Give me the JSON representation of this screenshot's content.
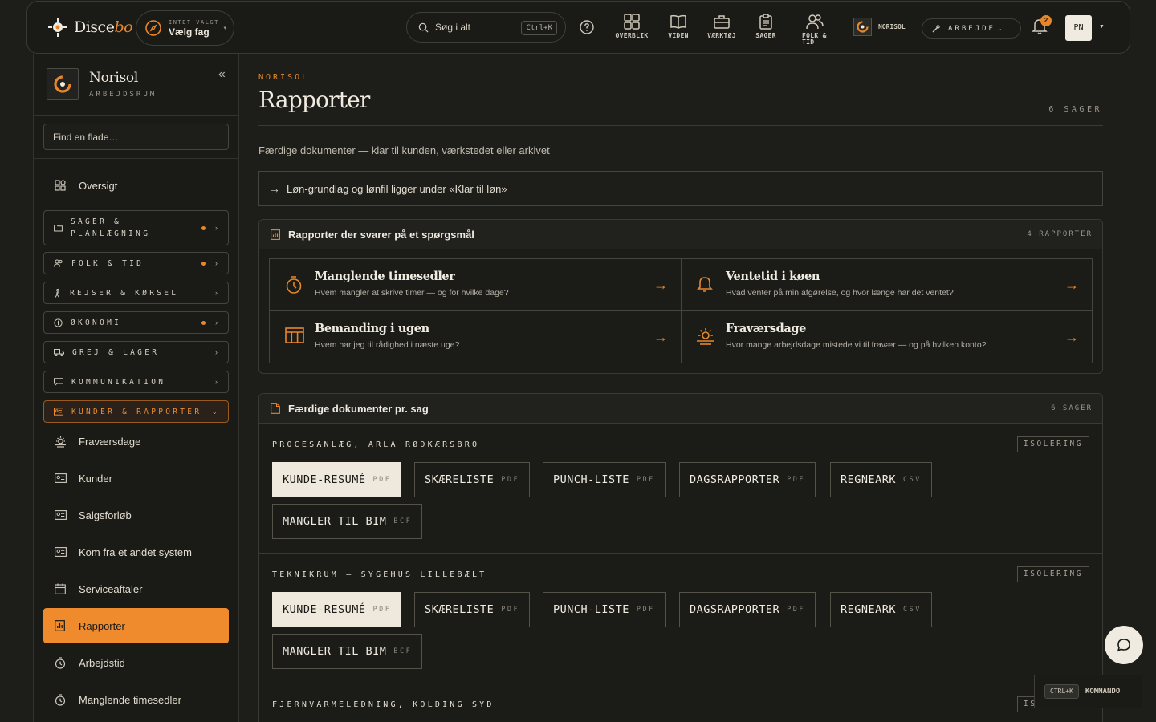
{
  "brand": {
    "name_a": "Disce",
    "name_b": "bo",
    "accent": "#e8872a"
  },
  "topbar": {
    "trade_small": "INTET VALGT",
    "trade_label": "Vælg fag",
    "search_label": "Søg i alt",
    "search_kbd": "Ctrl+K",
    "nav": [
      {
        "label": "OVERBLIK",
        "icon": "grid-icon"
      },
      {
        "label": "VIDEN",
        "icon": "book-icon"
      },
      {
        "label": "VÆRKTØJ",
        "icon": "toolbox-icon"
      },
      {
        "label": "SAGER",
        "icon": "clipboard-icon"
      },
      {
        "label_1": "FOLK &",
        "label_2": "TID",
        "icon": "people-icon"
      }
    ],
    "workspace_chip": "NORISOL",
    "mode_label": "ARBEJDE",
    "notification_count": "2",
    "avatar_initials": "PN"
  },
  "sidebar": {
    "workspace_name": "Norisol",
    "workspace_sub": "ARBEJDSRUM",
    "find_placeholder": "Find en flade…",
    "overview": "Oversigt",
    "groups": [
      {
        "label_1": "SAGER &",
        "label_2": "PLANLÆGNING",
        "dot": true
      },
      {
        "label": "FOLK & TID",
        "dot": true
      },
      {
        "label": "REJSER & KØRSEL",
        "dot": false
      },
      {
        "label": "ØKONOMI",
        "dot": true
      },
      {
        "label": "GREJ & LAGER",
        "dot": false
      },
      {
        "label": "KOMMUNIKATION",
        "dot": false
      },
      {
        "label": "KUNDER & RAPPORTER",
        "dot": false,
        "open": true
      }
    ],
    "items": [
      {
        "label": "Fraværsdage",
        "icon": "sun-horizon-icon"
      },
      {
        "label": "Kunder",
        "icon": "id-card-icon"
      },
      {
        "label": "Salgsforløb",
        "icon": "id-card-icon"
      },
      {
        "label": "Kom fra et andet system",
        "icon": "id-card-icon"
      },
      {
        "label": "Serviceaftaler",
        "icon": "calendar-icon"
      },
      {
        "label": "Rapporter",
        "icon": "report-icon",
        "active": true
      },
      {
        "label": "Arbejdstid",
        "icon": "stopwatch-icon"
      },
      {
        "label": "Manglende timesedler",
        "icon": "stopwatch-icon"
      }
    ]
  },
  "main": {
    "eyebrow": "NORISOL",
    "title": "Rapporter",
    "count": "6 SAGER",
    "subtitle": "Færdige dokumenter — klar til kunden, værkstedet eller arkivet",
    "notice": "Løn-grundlag og lønfil ligger under «Klar til løn»",
    "questions_panel": {
      "title": "Rapporter der svarer på et spørgsmål",
      "count": "4 RAPPORTER",
      "items": [
        {
          "title": "Manglende timesedler",
          "desc": "Hvem mangler at skrive timer — og for hvilke dage?",
          "icon": "stopwatch-icon"
        },
        {
          "title": "Ventetid i køen",
          "desc": "Hvad venter på min afgørelse, og hvor længe har det ventet?",
          "icon": "bell-icon"
        },
        {
          "title": "Bemanding i ugen",
          "desc": "Hvem har jeg til rådighed i næste uge?",
          "icon": "calendar-week-icon"
        },
        {
          "title": "Fraværsdage",
          "desc": "Hvor mange arbejdsdage mistede vi til fravær — og på hvilken konto?",
          "icon": "sun-horizon-icon"
        }
      ]
    },
    "docs_panel": {
      "title": "Færdige dokumenter pr. sag",
      "count": "6 SAGER",
      "jobs": [
        {
          "title": "PROCESANLÆG, ARLA RØDKÆRSBRO",
          "tag": "ISOLERING",
          "docs": [
            {
              "name": "KUNDE-RESUMÉ",
              "fmt": "PDF"
            },
            {
              "name": "SKÆRELISTE",
              "fmt": "PDF"
            },
            {
              "name": "PUNCH-LISTE",
              "fmt": "PDF"
            },
            {
              "name": "DAGSRAPPORTER",
              "fmt": "PDF"
            },
            {
              "name": "REGNEARK",
              "fmt": "CSV"
            },
            {
              "name": "MANGLER TIL BIM",
              "fmt": "BCF"
            }
          ]
        },
        {
          "title": "TEKNIKRUM — SYGEHUS LILLEBÆLT",
          "tag": "ISOLERING",
          "docs": [
            {
              "name": "KUNDE-RESUMÉ",
              "fmt": "PDF"
            },
            {
              "name": "SKÆRELISTE",
              "fmt": "PDF"
            },
            {
              "name": "PUNCH-LISTE",
              "fmt": "PDF"
            },
            {
              "name": "DAGSRAPPORTER",
              "fmt": "PDF"
            },
            {
              "name": "REGNEARK",
              "fmt": "CSV"
            },
            {
              "name": "MANGLER TIL BIM",
              "fmt": "BCF"
            }
          ]
        },
        {
          "title": "FJERNVARMELEDNING, KOLDING SYD",
          "tag": "ISOLERING"
        }
      ]
    }
  },
  "floating": {
    "cmd_kbd": "CTRL+K",
    "cmd_label": "KOMMANDO"
  }
}
